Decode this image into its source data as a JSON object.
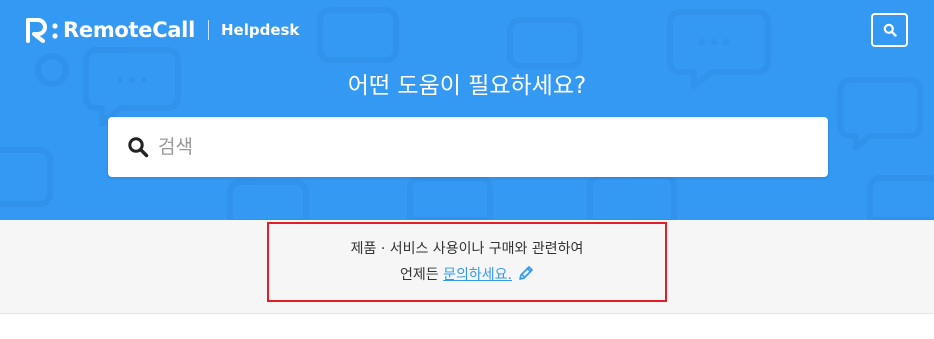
{
  "header": {
    "logo_text": "RemoteCall",
    "logo_subtitle": "Helpdesk",
    "logo_icon": "remotecall-r-icon",
    "search_button_icon": "search-icon"
  },
  "hero": {
    "headline": "어떤 도움이 필요하세요?",
    "search": {
      "placeholder": "검색",
      "value": "",
      "icon": "search-icon"
    },
    "background_color": "#3399f3"
  },
  "notice": {
    "line1": "제품 · 서비스 사용이나 구매와 관련하여",
    "line2_prefix": "언제든 ",
    "line2_link": "문의하세요.",
    "link_icon": "pencil-icon",
    "highlight_color": "#e31e24",
    "link_color": "#3399f3"
  }
}
